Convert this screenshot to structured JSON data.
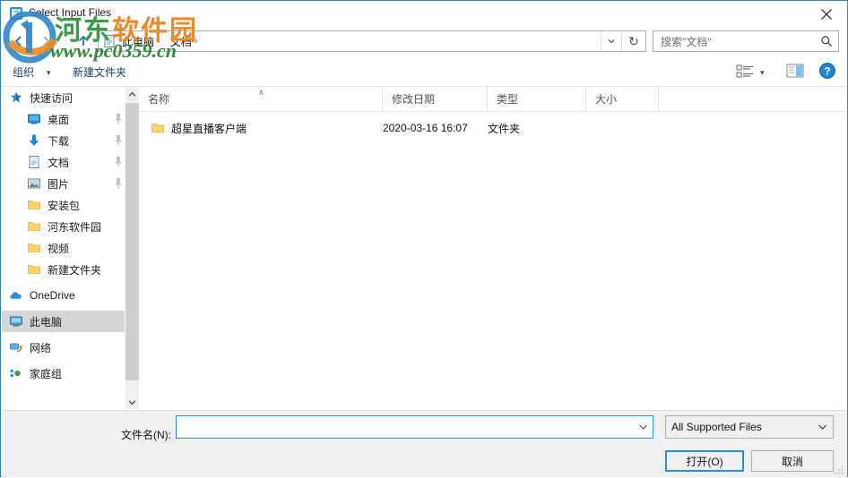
{
  "window": {
    "title": "Select Input Files",
    "icon": "app-icon",
    "close_label": "✕"
  },
  "nav": {
    "back_icon": "arrow-left-icon",
    "forward_icon": "arrow-right-icon",
    "up_icon": "arrow-up-icon",
    "breadcrumb_icon": "documents-icon",
    "breadcrumbs": [
      {
        "label": "此电脑",
        "sep": "›"
      },
      {
        "label": "文档",
        "sep": "›"
      }
    ],
    "dropdown_icon": "chevron-down-icon",
    "refresh_icon": "refresh-icon",
    "refresh_glyph": "↻"
  },
  "search": {
    "placeholder": "搜索\"文档\"",
    "icon": "search-icon"
  },
  "toolbar": {
    "organize_label": "组织",
    "organize_caret": "▾",
    "new_folder_label": "新建文件夹",
    "view_icon": "view-options-icon",
    "view_caret": "▾",
    "preview_icon": "preview-pane-icon",
    "help_icon": "help-icon",
    "help_glyph": "?"
  },
  "sidebar": {
    "items": [
      {
        "label": "快速访问",
        "icon": "star-icon",
        "indent": 1,
        "pinned": false,
        "selected": false
      },
      {
        "label": "桌面",
        "icon": "desktop-icon",
        "indent": 2,
        "pinned": true,
        "selected": false
      },
      {
        "label": "下载",
        "icon": "downloads-icon",
        "indent": 2,
        "pinned": true,
        "selected": false
      },
      {
        "label": "文档",
        "icon": "documents-icon",
        "indent": 2,
        "pinned": true,
        "selected": false
      },
      {
        "label": "图片",
        "icon": "pictures-icon",
        "indent": 2,
        "pinned": true,
        "selected": false
      },
      {
        "label": "安装包",
        "icon": "folder-icon",
        "indent": 2,
        "pinned": false,
        "selected": false
      },
      {
        "label": "河东软件园",
        "icon": "folder-icon",
        "indent": 2,
        "pinned": false,
        "selected": false
      },
      {
        "label": "视频",
        "icon": "folder-icon",
        "indent": 2,
        "pinned": false,
        "selected": false
      },
      {
        "label": "新建文件夹",
        "icon": "folder-icon",
        "indent": 2,
        "pinned": false,
        "selected": false
      },
      {
        "label": "OneDrive",
        "icon": "onedrive-icon",
        "indent": 1,
        "pinned": false,
        "selected": false
      },
      {
        "label": "此电脑",
        "icon": "this-pc-icon",
        "indent": 1,
        "pinned": false,
        "selected": true
      },
      {
        "label": "网络",
        "icon": "network-icon",
        "indent": 1,
        "pinned": false,
        "selected": false
      },
      {
        "label": "家庭组",
        "icon": "homegroup-icon",
        "indent": 1,
        "pinned": false,
        "selected": false
      }
    ],
    "scroll_up_glyph": "▲",
    "scroll_down_glyph": "▼"
  },
  "filelist": {
    "columns": [
      {
        "label": "名称",
        "sorted": true
      },
      {
        "label": "修改日期",
        "sorted": false
      },
      {
        "label": "类型",
        "sorted": false
      },
      {
        "label": "大小",
        "sorted": false
      }
    ],
    "sort_caret": "∧",
    "rows": [
      {
        "icon": "folder-icon",
        "name": "超星直播客户端",
        "date": "2020-03-16 16:07",
        "type": "文件夹",
        "size": ""
      }
    ]
  },
  "footer": {
    "filename_label": "文件名(N):",
    "filename_value": "",
    "filename_chevron": "⌄",
    "filetype_value": "All Supported Files",
    "filetype_chevron": "⌄",
    "open_label": "打开(O)",
    "cancel_label": "取消",
    "resize_grip": "resize-grip-icon"
  },
  "watermark": {
    "text_part1": "河东",
    "text_part2": "软件园",
    "url": "www.pc0359.cn",
    "color_green": "#3a9b45",
    "color_orange": "#e98b2a",
    "color_blue": "#2f86c5"
  },
  "colors": {
    "accent": "#2a8fd0",
    "frame_border": "#3a7fb1",
    "selection": "#d6d6d6",
    "panel": "#f0f0f0",
    "folder_yellow": "#fbd36b"
  }
}
